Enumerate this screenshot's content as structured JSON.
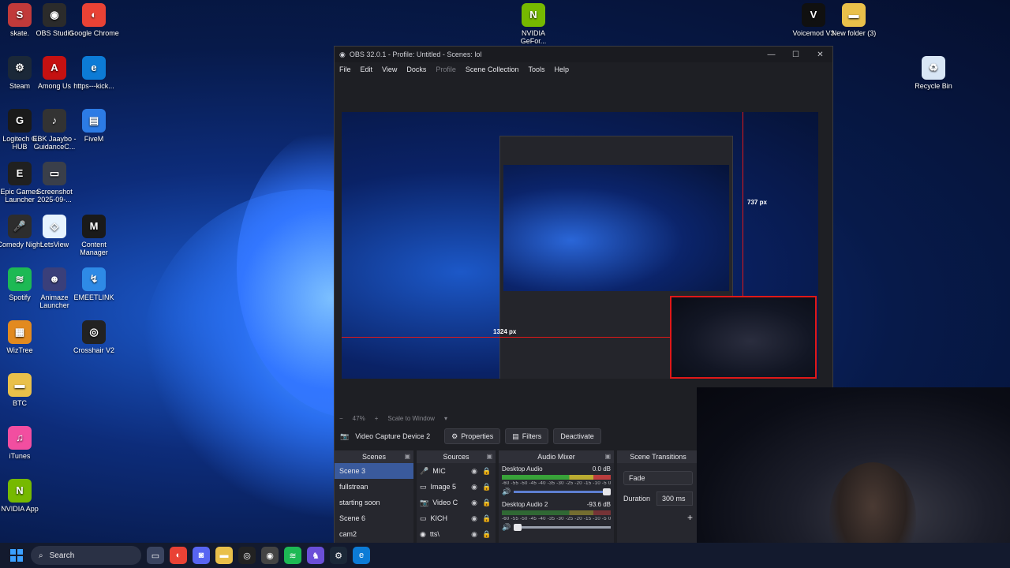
{
  "desktop": {
    "icons": [
      {
        "label": "skate.",
        "color": "#c13a3a",
        "glyph": "S"
      },
      {
        "label": "OBS Studio",
        "color": "#2b2b2b",
        "glyph": "◉"
      },
      {
        "label": "Google Chrome",
        "color": "#e94235",
        "glyph": "◐"
      },
      {
        "label": "Steam",
        "color": "#1b2838",
        "glyph": "⚙"
      },
      {
        "label": "Among Us",
        "color": "#c51111",
        "glyph": "A"
      },
      {
        "label": "https---kick...",
        "color": "#0c7bd6",
        "glyph": "e"
      },
      {
        "label": "Logitech G HUB",
        "color": "#1a1a1a",
        "glyph": "G"
      },
      {
        "label": "EBK Jaaybo - GuidanceC...",
        "color": "#333333",
        "glyph": "♪"
      },
      {
        "label": "FiveM",
        "color": "#2c7be5",
        "glyph": "▤"
      },
      {
        "label": "Epic Games Launcher",
        "color": "#202020",
        "glyph": "E"
      },
      {
        "label": "Screenshot 2025-09-...",
        "color": "#3a3f4a",
        "glyph": "▭"
      },
      {
        "label": "Comedy Night",
        "color": "#2d2d2d",
        "glyph": "🎤"
      },
      {
        "label": "LetsView",
        "color": "#e6f3ff",
        "glyph": "◇"
      },
      {
        "label": "Content Manager",
        "color": "#1a1a1a",
        "glyph": "M"
      },
      {
        "label": "Spotify",
        "color": "#1db954",
        "glyph": "≋"
      },
      {
        "label": "Animaze Launcher",
        "color": "#3a3f7a",
        "glyph": "☻"
      },
      {
        "label": "EMEETLINK",
        "color": "#2e8ae6",
        "glyph": "↯"
      },
      {
        "label": "WizTree",
        "color": "#e28a1f",
        "glyph": "▦"
      },
      {
        "label": "Crosshair V2",
        "color": "#222222",
        "glyph": "◎"
      },
      {
        "label": "BTC",
        "color": "#e9c04a",
        "glyph": "▬"
      },
      {
        "label": "iTunes",
        "color": "#f24ea0",
        "glyph": "♫"
      },
      {
        "label": "NVIDIA App",
        "color": "#76b900",
        "glyph": "N"
      },
      {
        "label": "NVIDIA GeFor...",
        "color": "#76b900",
        "glyph": "N"
      },
      {
        "label": "Voicemod V3",
        "color": "#101010",
        "glyph": "V"
      },
      {
        "label": "New folder (3)",
        "color": "#e9c04a",
        "glyph": "▬"
      },
      {
        "label": "Recycle Bin",
        "color": "#d8e6f5",
        "glyph": "♻"
      }
    ]
  },
  "obs": {
    "title": "OBS 32.0.1 - Profile: Untitled - Scenes: lol",
    "window_controls": {
      "minimize": "—",
      "maximize": "☐",
      "close": "✕"
    },
    "menu": [
      "File",
      "Edit",
      "View",
      "Docks",
      "Profile",
      "Scene Collection",
      "Tools",
      "Help"
    ],
    "preview": {
      "measure_h": "1324 px",
      "measure_v": "737 px",
      "zoom": "47%",
      "scale_mode": "Scale to Window"
    },
    "source_bar": {
      "source_name": "Video Capture Device 2",
      "properties": "Properties",
      "filters": "Filters",
      "deactivate": "Deactivate"
    },
    "scenes": {
      "title": "Scenes",
      "items": [
        "Scene 3",
        "fullstrean",
        "starting soon",
        "Scene 6",
        "cam2"
      ],
      "selected": "Scene 3"
    },
    "sources": {
      "title": "Sources",
      "items": [
        {
          "name": "MIC",
          "icon": "🎤"
        },
        {
          "name": "Image 5",
          "icon": "▭"
        },
        {
          "name": "Video C",
          "icon": "📷"
        },
        {
          "name": "KICH",
          "icon": "▭"
        },
        {
          "name": "tts\\",
          "icon": "◉"
        }
      ]
    },
    "mixer": {
      "title": "Audio Mixer",
      "channels": [
        {
          "name": "Desktop Audio",
          "level": "0.0 dB"
        },
        {
          "name": "Desktop Audio 2",
          "level": "-93.6 dB"
        }
      ],
      "scale": "-60 -55 -50 -45 -40 -35 -30 -25 -20 -15 -10 -5 0"
    },
    "transitions": {
      "title": "Scene Transitions",
      "type": "Fade",
      "duration_label": "Duration",
      "duration_value": "300 ms",
      "add": "+"
    }
  },
  "taskbar": {
    "search_placeholder": "Search",
    "apps": [
      {
        "name": "task-view",
        "glyph": "▭",
        "color": "#3a4460"
      },
      {
        "name": "chrome",
        "glyph": "◐",
        "color": "#e94235"
      },
      {
        "name": "discord",
        "glyph": "◙",
        "color": "#5865f2"
      },
      {
        "name": "file-explorer",
        "glyph": "▬",
        "color": "#e9c04a"
      },
      {
        "name": "crosshair",
        "glyph": "◎",
        "color": "#222222"
      },
      {
        "name": "obs",
        "glyph": "◉",
        "color": "#444444"
      },
      {
        "name": "spotify",
        "glyph": "≋",
        "color": "#1db954"
      },
      {
        "name": "game",
        "glyph": "♞",
        "color": "#6b4fd8"
      },
      {
        "name": "steam",
        "glyph": "⚙",
        "color": "#1b2838"
      },
      {
        "name": "edge",
        "glyph": "e",
        "color": "#0c7bd6"
      }
    ]
  }
}
